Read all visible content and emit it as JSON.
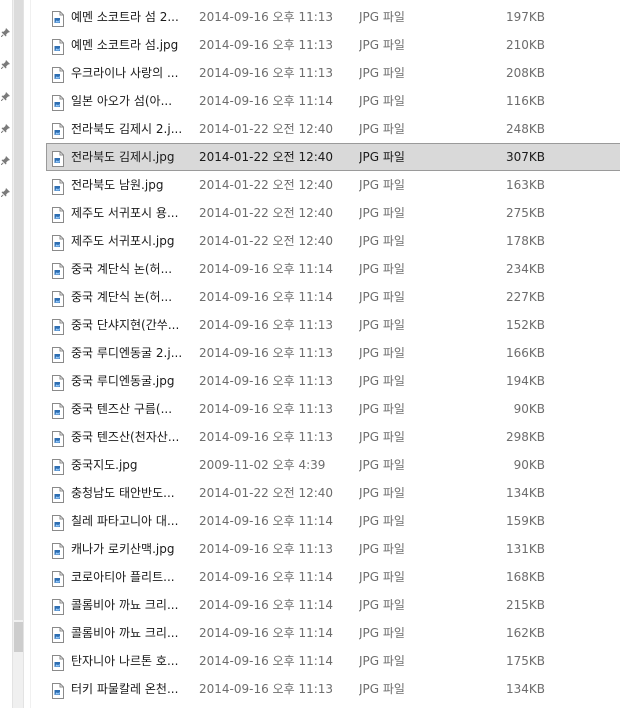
{
  "colors": {
    "selection_bg": "#d9d9d9",
    "selection_border": "#9a9a9a",
    "icon_blue": "#2f6fb3"
  },
  "nav_pane": {
    "pin_icons": [
      "pin-icon",
      "pin-icon",
      "pin-icon",
      "pin-icon",
      "pin-icon",
      "pin-icon"
    ]
  },
  "files": [
    {
      "name": "예멘 소코트라 섬 2...",
      "date": "2014-09-16 오후 11:13",
      "type": "JPG 파일",
      "size": "197KB",
      "icon": "jpg-file-icon",
      "selected": false
    },
    {
      "name": "예멘 소코트라 섬.jpg",
      "date": "2014-09-16 오후 11:13",
      "type": "JPG 파일",
      "size": "210KB",
      "icon": "jpg-file-icon",
      "selected": false
    },
    {
      "name": "우크라이나 사랑의 ...",
      "date": "2014-09-16 오후 11:13",
      "type": "JPG 파일",
      "size": "208KB",
      "icon": "jpg-file-icon",
      "selected": false
    },
    {
      "name": "일본 아오가 섬(아...",
      "date": "2014-09-16 오후 11:14",
      "type": "JPG 파일",
      "size": "116KB",
      "icon": "jpg-file-icon",
      "selected": false
    },
    {
      "name": "전라북도 김제시 2.j...",
      "date": "2014-01-22 오전 12:40",
      "type": "JPG 파일",
      "size": "248KB",
      "icon": "jpg-file-icon",
      "selected": false
    },
    {
      "name": "전라북도 김제시.jpg",
      "date": "2014-01-22 오전 12:40",
      "type": "JPG 파일",
      "size": "307KB",
      "icon": "jpg-file-icon",
      "selected": true
    },
    {
      "name": "전라북도 남원.jpg",
      "date": "2014-01-22 오전 12:40",
      "type": "JPG 파일",
      "size": "163KB",
      "icon": "jpg-file-icon",
      "selected": false
    },
    {
      "name": "제주도 서귀포시 용...",
      "date": "2014-01-22 오전 12:40",
      "type": "JPG 파일",
      "size": "275KB",
      "icon": "jpg-file-icon",
      "selected": false
    },
    {
      "name": "제주도 서귀포시.jpg",
      "date": "2014-01-22 오전 12:40",
      "type": "JPG 파일",
      "size": "178KB",
      "icon": "jpg-file-icon",
      "selected": false
    },
    {
      "name": "중국 계단식 논(허...",
      "date": "2014-09-16 오후 11:14",
      "type": "JPG 파일",
      "size": "234KB",
      "icon": "jpg-file-icon",
      "selected": false
    },
    {
      "name": "중국 계단식 논(허...",
      "date": "2014-09-16 오후 11:14",
      "type": "JPG 파일",
      "size": "227KB",
      "icon": "jpg-file-icon",
      "selected": false
    },
    {
      "name": "중국 단샤지현(간쑤...",
      "date": "2014-09-16 오후 11:13",
      "type": "JPG 파일",
      "size": "152KB",
      "icon": "jpg-file-icon",
      "selected": false
    },
    {
      "name": "중국 루디엔동굴 2.j...",
      "date": "2014-09-16 오후 11:13",
      "type": "JPG 파일",
      "size": "166KB",
      "icon": "jpg-file-icon",
      "selected": false
    },
    {
      "name": "중국 루디엔동굴.jpg",
      "date": "2014-09-16 오후 11:13",
      "type": "JPG 파일",
      "size": "194KB",
      "icon": "jpg-file-icon",
      "selected": false
    },
    {
      "name": "중국 텐즈산 구름(...",
      "date": "2014-09-16 오후 11:13",
      "type": "JPG 파일",
      "size": "90KB",
      "icon": "jpg-file-icon",
      "selected": false
    },
    {
      "name": "중국 텐즈산(천자산...",
      "date": "2014-09-16 오후 11:13",
      "type": "JPG 파일",
      "size": "298KB",
      "icon": "jpg-file-icon",
      "selected": false
    },
    {
      "name": "중국지도.jpg",
      "date": "2009-11-02 오후 4:39",
      "type": "JPG 파일",
      "size": "90KB",
      "icon": "jpg-file-icon",
      "selected": false
    },
    {
      "name": "충청남도 태안반도...",
      "date": "2014-01-22 오전 12:40",
      "type": "JPG 파일",
      "size": "134KB",
      "icon": "jpg-file-icon",
      "selected": false
    },
    {
      "name": "칠레 파타고니아 대...",
      "date": "2014-09-16 오후 11:14",
      "type": "JPG 파일",
      "size": "159KB",
      "icon": "jpg-file-icon",
      "selected": false
    },
    {
      "name": "캐나가 로키산맥.jpg",
      "date": "2014-09-16 오후 11:13",
      "type": "JPG 파일",
      "size": "131KB",
      "icon": "jpg-file-icon",
      "selected": false
    },
    {
      "name": "코로아티아 플리트...",
      "date": "2014-09-16 오후 11:14",
      "type": "JPG 파일",
      "size": "168KB",
      "icon": "jpg-file-icon",
      "selected": false
    },
    {
      "name": "콜롬비아 까뇨 크리...",
      "date": "2014-09-16 오후 11:14",
      "type": "JPG 파일",
      "size": "215KB",
      "icon": "jpg-file-icon",
      "selected": false
    },
    {
      "name": "콜롬비아 까뇨 크리...",
      "date": "2014-09-16 오후 11:14",
      "type": "JPG 파일",
      "size": "162KB",
      "icon": "jpg-file-icon",
      "selected": false
    },
    {
      "name": "탄자니아 나르톤 호...",
      "date": "2014-09-16 오후 11:14",
      "type": "JPG 파일",
      "size": "175KB",
      "icon": "jpg-file-icon",
      "selected": false
    },
    {
      "name": "터키 파물칼레 온천...",
      "date": "2014-09-16 오후 11:13",
      "type": "JPG 파일",
      "size": "134KB",
      "icon": "jpg-file-icon",
      "selected": false
    }
  ]
}
